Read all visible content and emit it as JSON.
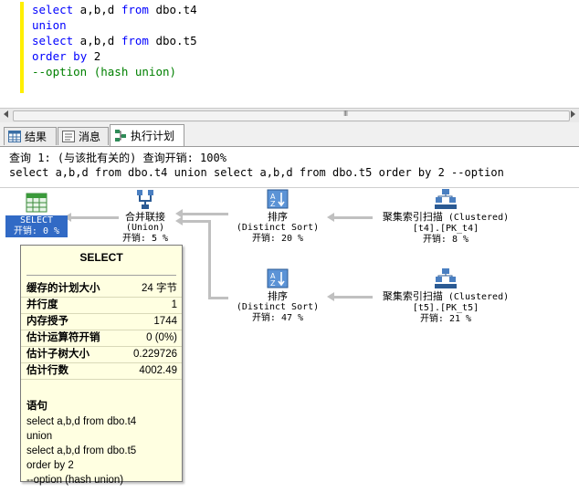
{
  "editor": {
    "lines": [
      [
        {
          "t": "select",
          "c": "kw"
        },
        {
          "t": " a,b,d ",
          "c": "txt"
        },
        {
          "t": "from",
          "c": "kw"
        },
        {
          "t": " dbo.t4",
          "c": "obj"
        }
      ],
      [
        {
          "t": "union",
          "c": "kw"
        }
      ],
      [
        {
          "t": "select",
          "c": "kw"
        },
        {
          "t": " a,b,d ",
          "c": "txt"
        },
        {
          "t": "from",
          "c": "kw"
        },
        {
          "t": " dbo.t5",
          "c": "obj"
        }
      ],
      [
        {
          "t": "order",
          "c": "kw"
        },
        {
          "t": " ",
          "c": "txt"
        },
        {
          "t": "by",
          "c": "kw"
        },
        {
          "t": " 2",
          "c": "txt"
        }
      ],
      [
        {
          "t": "--option (hash union)",
          "c": "cmt"
        }
      ]
    ]
  },
  "scrollbar": {
    "grip": "III"
  },
  "tabs": [
    {
      "label": "结果",
      "icon": "grid-icon"
    },
    {
      "label": "消息",
      "icon": "message-icon"
    },
    {
      "label": "执行计划",
      "icon": "plan-icon",
      "active": true
    }
  ],
  "plan": {
    "query_header": "查询 1: (与该批有关的) 查询开销: 100%",
    "query_text": "select a,b,d from dbo.t4 union select a,b,d from dbo.t5 order by 2 --option",
    "nodes": {
      "select": {
        "name": "SELECT",
        "cost": "开销: 0 %"
      },
      "concat": {
        "name": "合并联接",
        "sub": "(Union)",
        "cost": "开销: 5 %"
      },
      "sort1": {
        "name": "排序",
        "sub": "(Distinct Sort)",
        "cost": "开销: 20 %"
      },
      "sort2": {
        "name": "排序",
        "sub": "(Distinct Sort)",
        "cost": "开销: 47 %"
      },
      "scan1": {
        "name": "聚集索引扫描",
        "suffix": " (Clustered)",
        "sub": "[t4].[PK_t4]",
        "cost": "开销: 8 %"
      },
      "scan2": {
        "name": "聚集索引扫描",
        "suffix": " (Clustered)",
        "sub": "[t5].[PK_t5]",
        "cost": "开销: 21 %"
      }
    }
  },
  "tooltip": {
    "title": "SELECT",
    "rows": [
      {
        "k": "缓存的计划大小",
        "v": "24 字节"
      },
      {
        "k": "并行度",
        "v": "1"
      },
      {
        "k": "内存授予",
        "v": "1744"
      },
      {
        "k": "估计运算符开销",
        "v": "0 (0%)"
      },
      {
        "k": "估计子树大小",
        "v": "0.229726"
      },
      {
        "k": "估计行数",
        "v": "4002.49"
      }
    ],
    "statement_label": "语句",
    "statement_lines": [
      "select a,b,d from dbo.t4",
      "union",
      "select a,b,d from dbo.t5",
      "order by 2",
      "--option (hash union)"
    ]
  },
  "colors": {
    "keyword": "#0000ff",
    "comment": "#008000",
    "selection": "#316ac5",
    "tooltip_bg": "#ffffe1",
    "marker": "#ffef00"
  }
}
